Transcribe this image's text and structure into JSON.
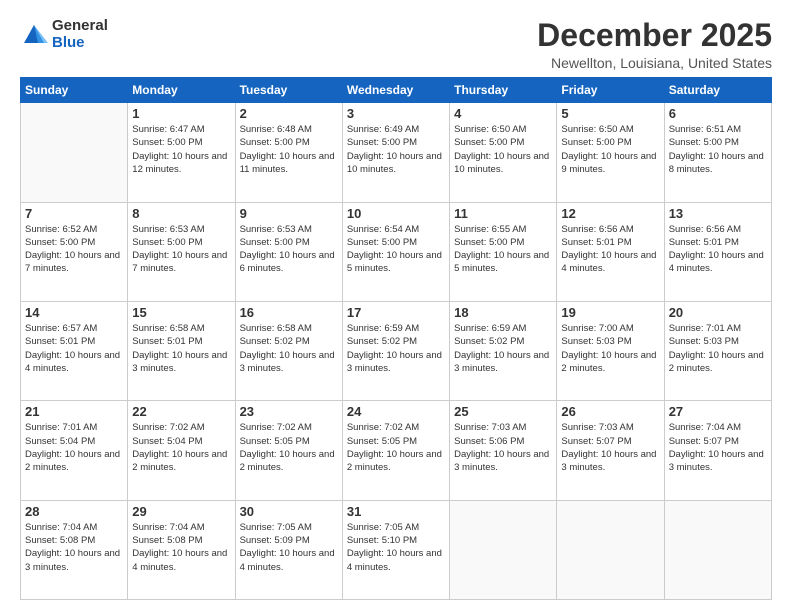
{
  "logo": {
    "general": "General",
    "blue": "Blue"
  },
  "header": {
    "month": "December 2025",
    "location": "Newellton, Louisiana, United States"
  },
  "weekdays": [
    "Sunday",
    "Monday",
    "Tuesday",
    "Wednesday",
    "Thursday",
    "Friday",
    "Saturday"
  ],
  "weeks": [
    [
      {
        "day": "",
        "sunrise": "",
        "sunset": "",
        "daylight": ""
      },
      {
        "day": "1",
        "sunrise": "Sunrise: 6:47 AM",
        "sunset": "Sunset: 5:00 PM",
        "daylight": "Daylight: 10 hours and 12 minutes."
      },
      {
        "day": "2",
        "sunrise": "Sunrise: 6:48 AM",
        "sunset": "Sunset: 5:00 PM",
        "daylight": "Daylight: 10 hours and 11 minutes."
      },
      {
        "day": "3",
        "sunrise": "Sunrise: 6:49 AM",
        "sunset": "Sunset: 5:00 PM",
        "daylight": "Daylight: 10 hours and 10 minutes."
      },
      {
        "day": "4",
        "sunrise": "Sunrise: 6:50 AM",
        "sunset": "Sunset: 5:00 PM",
        "daylight": "Daylight: 10 hours and 10 minutes."
      },
      {
        "day": "5",
        "sunrise": "Sunrise: 6:50 AM",
        "sunset": "Sunset: 5:00 PM",
        "daylight": "Daylight: 10 hours and 9 minutes."
      },
      {
        "day": "6",
        "sunrise": "Sunrise: 6:51 AM",
        "sunset": "Sunset: 5:00 PM",
        "daylight": "Daylight: 10 hours and 8 minutes."
      }
    ],
    [
      {
        "day": "7",
        "sunrise": "Sunrise: 6:52 AM",
        "sunset": "Sunset: 5:00 PM",
        "daylight": "Daylight: 10 hours and 7 minutes."
      },
      {
        "day": "8",
        "sunrise": "Sunrise: 6:53 AM",
        "sunset": "Sunset: 5:00 PM",
        "daylight": "Daylight: 10 hours and 7 minutes."
      },
      {
        "day": "9",
        "sunrise": "Sunrise: 6:53 AM",
        "sunset": "Sunset: 5:00 PM",
        "daylight": "Daylight: 10 hours and 6 minutes."
      },
      {
        "day": "10",
        "sunrise": "Sunrise: 6:54 AM",
        "sunset": "Sunset: 5:00 PM",
        "daylight": "Daylight: 10 hours and 5 minutes."
      },
      {
        "day": "11",
        "sunrise": "Sunrise: 6:55 AM",
        "sunset": "Sunset: 5:00 PM",
        "daylight": "Daylight: 10 hours and 5 minutes."
      },
      {
        "day": "12",
        "sunrise": "Sunrise: 6:56 AM",
        "sunset": "Sunset: 5:01 PM",
        "daylight": "Daylight: 10 hours and 4 minutes."
      },
      {
        "day": "13",
        "sunrise": "Sunrise: 6:56 AM",
        "sunset": "Sunset: 5:01 PM",
        "daylight": "Daylight: 10 hours and 4 minutes."
      }
    ],
    [
      {
        "day": "14",
        "sunrise": "Sunrise: 6:57 AM",
        "sunset": "Sunset: 5:01 PM",
        "daylight": "Daylight: 10 hours and 4 minutes."
      },
      {
        "day": "15",
        "sunrise": "Sunrise: 6:58 AM",
        "sunset": "Sunset: 5:01 PM",
        "daylight": "Daylight: 10 hours and 3 minutes."
      },
      {
        "day": "16",
        "sunrise": "Sunrise: 6:58 AM",
        "sunset": "Sunset: 5:02 PM",
        "daylight": "Daylight: 10 hours and 3 minutes."
      },
      {
        "day": "17",
        "sunrise": "Sunrise: 6:59 AM",
        "sunset": "Sunset: 5:02 PM",
        "daylight": "Daylight: 10 hours and 3 minutes."
      },
      {
        "day": "18",
        "sunrise": "Sunrise: 6:59 AM",
        "sunset": "Sunset: 5:02 PM",
        "daylight": "Daylight: 10 hours and 3 minutes."
      },
      {
        "day": "19",
        "sunrise": "Sunrise: 7:00 AM",
        "sunset": "Sunset: 5:03 PM",
        "daylight": "Daylight: 10 hours and 2 minutes."
      },
      {
        "day": "20",
        "sunrise": "Sunrise: 7:01 AM",
        "sunset": "Sunset: 5:03 PM",
        "daylight": "Daylight: 10 hours and 2 minutes."
      }
    ],
    [
      {
        "day": "21",
        "sunrise": "Sunrise: 7:01 AM",
        "sunset": "Sunset: 5:04 PM",
        "daylight": "Daylight: 10 hours and 2 minutes."
      },
      {
        "day": "22",
        "sunrise": "Sunrise: 7:02 AM",
        "sunset": "Sunset: 5:04 PM",
        "daylight": "Daylight: 10 hours and 2 minutes."
      },
      {
        "day": "23",
        "sunrise": "Sunrise: 7:02 AM",
        "sunset": "Sunset: 5:05 PM",
        "daylight": "Daylight: 10 hours and 2 minutes."
      },
      {
        "day": "24",
        "sunrise": "Sunrise: 7:02 AM",
        "sunset": "Sunset: 5:05 PM",
        "daylight": "Daylight: 10 hours and 2 minutes."
      },
      {
        "day": "25",
        "sunrise": "Sunrise: 7:03 AM",
        "sunset": "Sunset: 5:06 PM",
        "daylight": "Daylight: 10 hours and 3 minutes."
      },
      {
        "day": "26",
        "sunrise": "Sunrise: 7:03 AM",
        "sunset": "Sunset: 5:07 PM",
        "daylight": "Daylight: 10 hours and 3 minutes."
      },
      {
        "day": "27",
        "sunrise": "Sunrise: 7:04 AM",
        "sunset": "Sunset: 5:07 PM",
        "daylight": "Daylight: 10 hours and 3 minutes."
      }
    ],
    [
      {
        "day": "28",
        "sunrise": "Sunrise: 7:04 AM",
        "sunset": "Sunset: 5:08 PM",
        "daylight": "Daylight: 10 hours and 3 minutes."
      },
      {
        "day": "29",
        "sunrise": "Sunrise: 7:04 AM",
        "sunset": "Sunset: 5:08 PM",
        "daylight": "Daylight: 10 hours and 4 minutes."
      },
      {
        "day": "30",
        "sunrise": "Sunrise: 7:05 AM",
        "sunset": "Sunset: 5:09 PM",
        "daylight": "Daylight: 10 hours and 4 minutes."
      },
      {
        "day": "31",
        "sunrise": "Sunrise: 7:05 AM",
        "sunset": "Sunset: 5:10 PM",
        "daylight": "Daylight: 10 hours and 4 minutes."
      },
      {
        "day": "",
        "sunrise": "",
        "sunset": "",
        "daylight": ""
      },
      {
        "day": "",
        "sunrise": "",
        "sunset": "",
        "daylight": ""
      },
      {
        "day": "",
        "sunrise": "",
        "sunset": "",
        "daylight": ""
      }
    ]
  ]
}
